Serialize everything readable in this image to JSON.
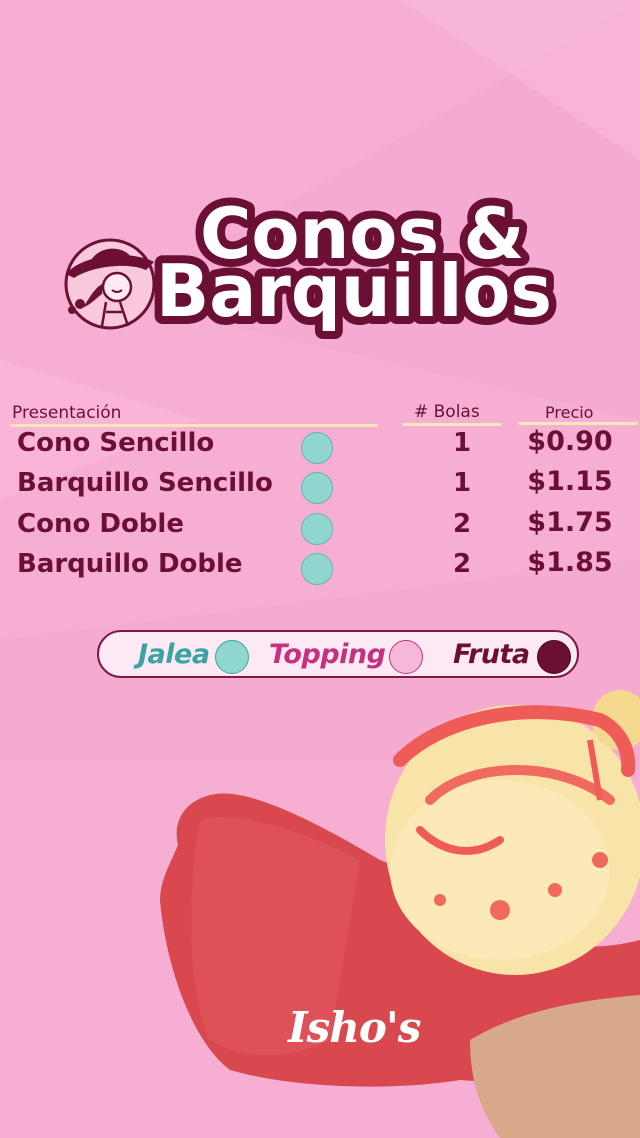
{
  "header": {
    "title_line1": "Conos &",
    "title_line2": "Barquillos"
  },
  "table": {
    "headers": {
      "presentation": "Presentación",
      "count": "# Bolas",
      "price": "Precio"
    },
    "rows": [
      {
        "name": "Cono Sencillo",
        "count": "1",
        "price": "$0.90"
      },
      {
        "name": "Barquillo Sencillo",
        "count": "1",
        "price": "$1.15"
      },
      {
        "name": "Cono Doble",
        "count": "2",
        "price": "$1.75"
      },
      {
        "name": "Barquillo Doble",
        "count": "2",
        "price": "$1.85"
      }
    ]
  },
  "extras": [
    {
      "label": "Jalea",
      "color": "#3aa3a3",
      "icon": "vendor-teal-icon"
    },
    {
      "label": "Topping",
      "color": "#c4317e",
      "icon": "woman-hat-pink-icon"
    },
    {
      "label": "Fruta",
      "color": "#6b0f34",
      "icon": "fruit-bowl-icon"
    }
  ],
  "brand": "Isho's",
  "colors": {
    "background": "#f6aed3",
    "primary": "#6b0f34",
    "accent_teal": "#8fd6cf"
  }
}
